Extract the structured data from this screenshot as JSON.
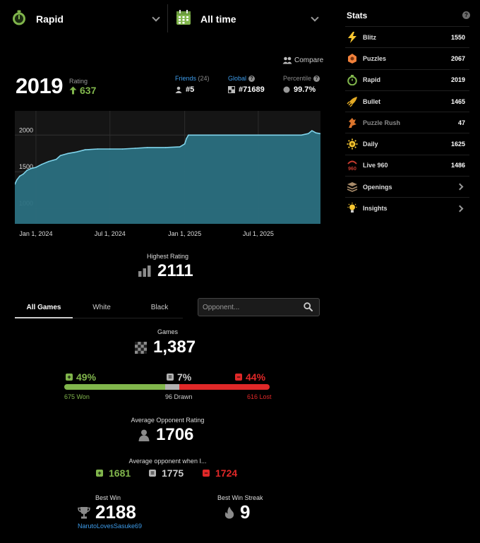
{
  "selectors": {
    "game_type": "Rapid",
    "time_range": "All time"
  },
  "compare_label": "Compare",
  "rating": {
    "value": "2019",
    "label": "Rating",
    "delta": "637"
  },
  "friends": {
    "label": "Friends",
    "count": "(24)",
    "rank": "#5"
  },
  "global": {
    "label": "Global",
    "rank": "#71689"
  },
  "percentile": {
    "label": "Percentile",
    "value": "99.7%"
  },
  "chart_data": {
    "type": "area",
    "x_tick_labels": [
      "Jan 1, 2024",
      "Jul 1, 2024",
      "Jan 1, 2025",
      "Jul 1, 2025"
    ],
    "y_tick_labels": [
      "2000",
      "1500",
      "1000"
    ],
    "ylim": [
      790,
      2330
    ],
    "series": [
      {
        "points": [
          [
            "2023-11-10",
            1330
          ],
          [
            "2023-11-15",
            1390
          ],
          [
            "2023-11-22",
            1440
          ],
          [
            "2023-12-01",
            1470
          ],
          [
            "2023-12-10",
            1520
          ],
          [
            "2023-12-20",
            1545
          ],
          [
            "2024-01-01",
            1560
          ],
          [
            "2024-01-15",
            1600
          ],
          [
            "2024-02-01",
            1640
          ],
          [
            "2024-02-20",
            1670
          ],
          [
            "2024-03-01",
            1720
          ],
          [
            "2024-03-20",
            1750
          ],
          [
            "2024-04-10",
            1770
          ],
          [
            "2024-05-01",
            1800
          ],
          [
            "2024-06-01",
            1810
          ],
          [
            "2024-07-01",
            1810
          ],
          [
            "2024-08-01",
            1810
          ],
          [
            "2024-09-01",
            1820
          ],
          [
            "2024-10-01",
            1830
          ],
          [
            "2024-11-15",
            1830
          ],
          [
            "2024-12-20",
            1840
          ],
          [
            "2025-01-01",
            1880
          ],
          [
            "2025-01-05",
            1950
          ],
          [
            "2025-01-10",
            2000
          ],
          [
            "2025-03-01",
            2000
          ],
          [
            "2025-06-01",
            2000
          ],
          [
            "2025-09-01",
            2000
          ],
          [
            "2025-10-15",
            2000
          ],
          [
            "2025-11-01",
            2020
          ],
          [
            "2025-11-10",
            2060
          ],
          [
            "2025-11-20",
            2030
          ],
          [
            "2025-12-01",
            2019
          ]
        ]
      }
    ],
    "grid": true,
    "colors": {
      "fill": "#2a6f80",
      "line": "#7fd3ea",
      "background": "#151515"
    }
  },
  "highest_rating": {
    "label": "Highest Rating",
    "value": "2111"
  },
  "tabs": {
    "all": "All Games",
    "white": "White",
    "black": "Black"
  },
  "opponent_input": {
    "placeholder": "Opponent..."
  },
  "games": {
    "label": "Games",
    "total": "1,387",
    "won_pct": "49%",
    "drawn_pct": "7%",
    "lost_pct": "44%",
    "won_count": "675 Won",
    "drawn_count": "96 Drawn",
    "lost_count": "616 Lost",
    "fractions": {
      "won": 0.49,
      "drawn": 0.07,
      "lost": 0.44
    }
  },
  "avg_opponent": {
    "label": "Average Opponent Rating",
    "value": "1706"
  },
  "avg_opponent_when": {
    "label": "Average opponent when I...",
    "won": "1681",
    "drawn": "1775",
    "lost": "1724"
  },
  "best_win": {
    "label": "Best Win",
    "value": "2188",
    "user": "NarutoLovesSasuke69"
  },
  "best_streak": {
    "label": "Best Win Streak",
    "value": "9"
  },
  "sidebar": {
    "title": "Stats",
    "items": [
      {
        "name": "Blitz",
        "value": "1550",
        "icon": "lightning-icon"
      },
      {
        "name": "Puzzles",
        "value": "2067",
        "icon": "puzzle-icon"
      },
      {
        "name": "Rapid",
        "value": "2019",
        "icon": "stopwatch-icon"
      },
      {
        "name": "Bullet",
        "value": "1465",
        "icon": "bullet-icon"
      },
      {
        "name": "Puzzle Rush",
        "value": "47",
        "icon": "puzzle-rush-icon"
      },
      {
        "name": "Daily",
        "value": "1625",
        "icon": "sun-icon"
      },
      {
        "name": "Live 960",
        "value": "1486",
        "icon": "960-icon"
      },
      {
        "name": "Openings",
        "value": "",
        "icon": "openings-icon"
      },
      {
        "name": "Insights",
        "value": "",
        "icon": "lightbulb-icon"
      }
    ]
  },
  "colors": {
    "win": "#81b64c",
    "draw": "#b2b2b2",
    "loss": "#e02828",
    "link": "#3d9be9"
  }
}
